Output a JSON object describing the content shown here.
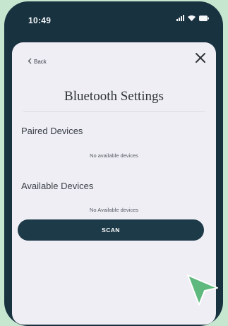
{
  "status_bar": {
    "time": "10:49",
    "icons": [
      "signal-icon",
      "wifi-icon",
      "battery-icon"
    ]
  },
  "header": {
    "back_label": "Back",
    "title": "Bluetooth Settings"
  },
  "paired": {
    "heading": "Paired Devices",
    "empty_text": "No available devices"
  },
  "available": {
    "heading": "Available Devices",
    "empty_text": "No Available devices"
  },
  "scan_button_label": "SCAN",
  "colors": {
    "background": "#c7e6cf",
    "phone_body": "#183240",
    "card": "#efeef5",
    "button": "#1d3a49",
    "cursor": "#5fb87d"
  }
}
